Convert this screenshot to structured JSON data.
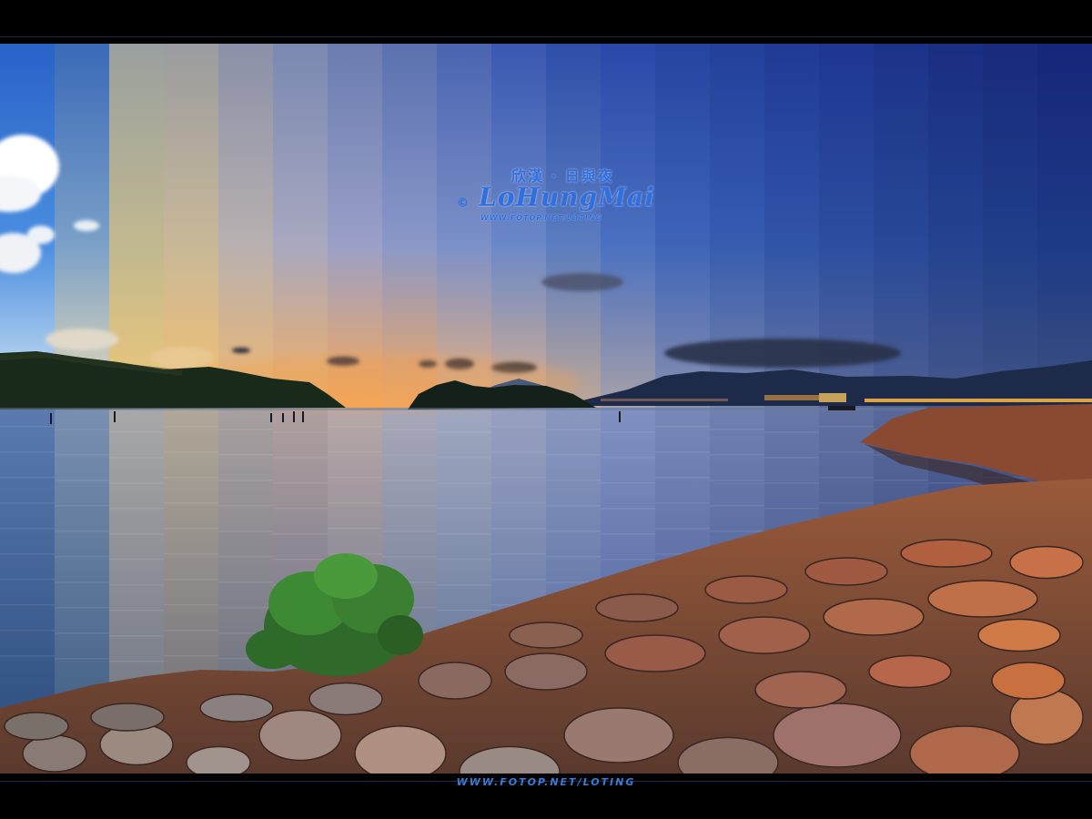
{
  "watermark": {
    "chinese": "欣漢 · 日與夜",
    "copyright": "©",
    "signature": "LoHungMai",
    "url": "WWW.FOTOP.NET/LOTING"
  },
  "footer": {
    "url": "WWW.FOTOP.NET/LOTING"
  },
  "colors": {
    "frame": "#000000",
    "watermark": "#2f6fe0",
    "footer_text": "#3a7bd5"
  },
  "strips": {
    "count": 20,
    "description_note": null
  }
}
